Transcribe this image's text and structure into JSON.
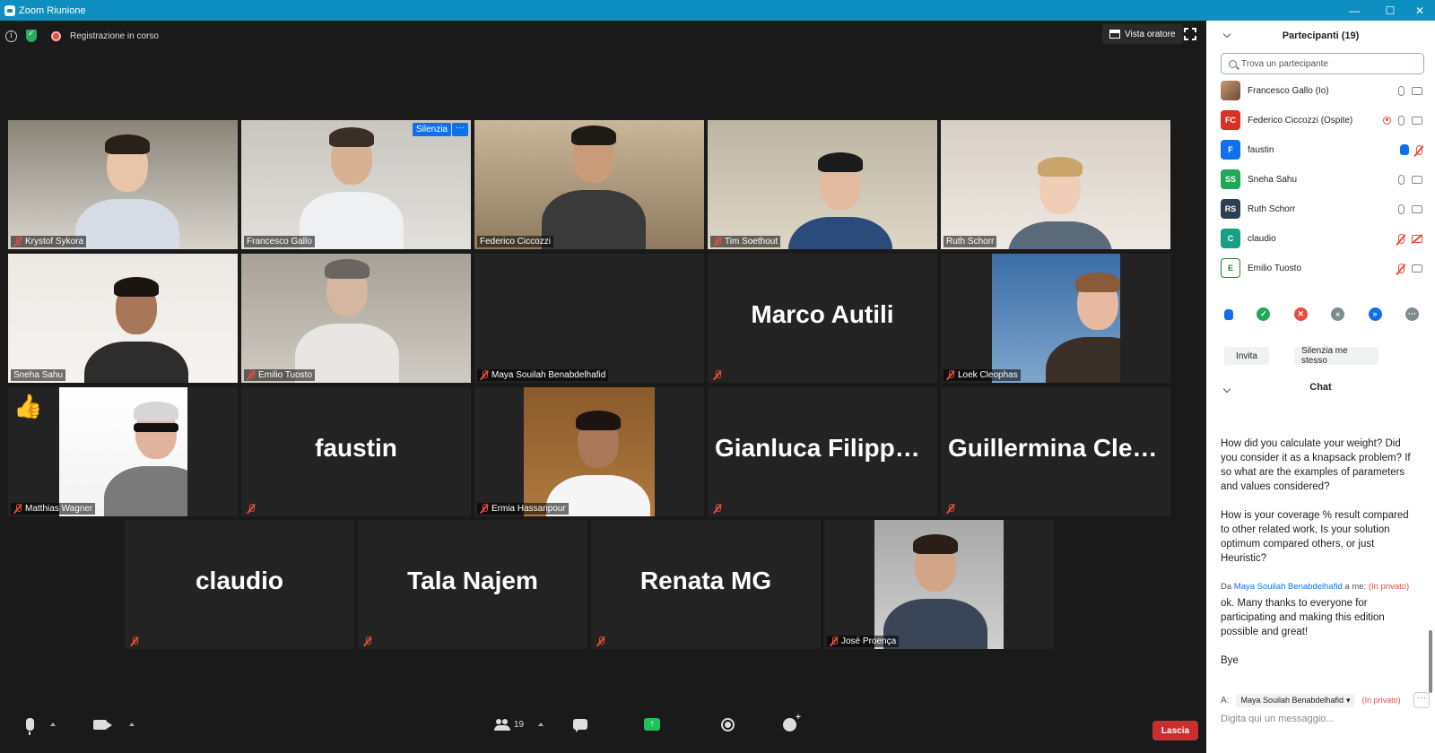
{
  "window": {
    "title": "Zoom Riunione"
  },
  "top_bar": {
    "recording_label": "Registrazione in corso",
    "view_button": "Vista oratore"
  },
  "tiles": [
    {
      "name": "Krystof Sykora",
      "video": true,
      "muted": true
    },
    {
      "name": "Francesco Gallo",
      "video": true,
      "muted": false,
      "active": true,
      "mute_button": "Silenzia",
      "more_button": "···"
    },
    {
      "name": "Federico Ciccozzi",
      "video": true,
      "muted": false
    },
    {
      "name": "Tim Soethout",
      "video": true,
      "muted": true
    },
    {
      "name": "Ruth Schorr",
      "video": true,
      "muted": false
    },
    {
      "name": "Sneha Sahu",
      "video": true,
      "muted": false
    },
    {
      "name": "Emilio Tuosto",
      "video": true,
      "muted": true
    },
    {
      "name": "Maya Souilah Benabdelhafid",
      "video": false,
      "muted": true,
      "big_name": ""
    },
    {
      "name": "",
      "video": false,
      "muted": true,
      "big_name": "Marco Autili"
    },
    {
      "name": "Loek Cleophas",
      "video": true,
      "muted": true
    },
    {
      "name": "Matthias Wagner",
      "video": true,
      "muted": true,
      "reaction": "👍"
    },
    {
      "name": "",
      "video": false,
      "muted": true,
      "big_name": "faustin"
    },
    {
      "name": "Ermia Hassanpour",
      "video": true,
      "muted": true
    },
    {
      "name": "",
      "video": false,
      "muted": true,
      "big_name": "Gianluca  Filippo..."
    },
    {
      "name": "",
      "video": false,
      "muted": true,
      "big_name": "Guillermina  Cled..."
    },
    {
      "name": "",
      "video": false,
      "muted": true,
      "big_name": "claudio"
    },
    {
      "name": "",
      "video": false,
      "muted": true,
      "big_name": "Tala Najem"
    },
    {
      "name": "",
      "video": false,
      "muted": true,
      "big_name": "Renata MG"
    },
    {
      "name": "José Proença",
      "video": true,
      "muted": true
    }
  ],
  "toolbar": {
    "participants_count": "19",
    "leave_label": "Lascia"
  },
  "participants_panel": {
    "title": "Partecipanti (19)",
    "search_placeholder": "Trova un partecipante",
    "list": [
      {
        "initials": "",
        "name": "Francesco Gallo (Io)",
        "color": "#b07a55",
        "photo": true,
        "mic": "on",
        "cam": "on"
      },
      {
        "initials": "FC",
        "name": "Federico Ciccozzi (Ospite)",
        "color": "#d93025",
        "mic": "on",
        "cam": "on",
        "rec": true
      },
      {
        "initials": "F",
        "name": "faustin",
        "color": "#0e71eb",
        "hand": true,
        "mic": "off",
        "cam": "none"
      },
      {
        "initials": "SS",
        "name": "Sneha Sahu",
        "color": "#1fa855",
        "mic": "on",
        "cam": "on"
      },
      {
        "initials": "RS",
        "name": "Ruth Schorr",
        "color": "#2c3e50",
        "mic": "on",
        "cam": "on"
      },
      {
        "initials": "C",
        "name": "claudio",
        "color": "#16a085",
        "mic": "off",
        "cam": "off"
      },
      {
        "initials": "E",
        "name": "Emilio Tuosto",
        "color": "#2d7d2d",
        "mic": "off",
        "cam": "on"
      }
    ],
    "invite_button": "Invita",
    "mute_me_button": "Silenzia me stesso"
  },
  "chat": {
    "title": "Chat",
    "messages": [
      "How did you calculate your weight? Did you consider it as a knapsack problem? If so what are the examples of parameters  and values considered?",
      "How is your coverage % result compared to other related work, Is your solution optimum compared others, or just Heuristic?"
    ],
    "private_from_prefix": "Da",
    "private_from_name": "Maya Souilah Benabdelhafid",
    "private_to": "a me:",
    "private_tag": "(In privato)",
    "private_messages": [
      "ok. Many thanks to everyone for participating and making this edition possible and great!",
      "Bye"
    ],
    "to_label": "A:",
    "to_recipient": "Maya Souilah Benabdelhafid",
    "to_private": "(In privato)",
    "input_placeholder": "Digita qui un messaggio..."
  },
  "colors": {
    "title_bar": "#0e8fc2",
    "active_speaker": "#d7e86a",
    "leave": "#c8302f",
    "accent": "#0e71eb"
  }
}
